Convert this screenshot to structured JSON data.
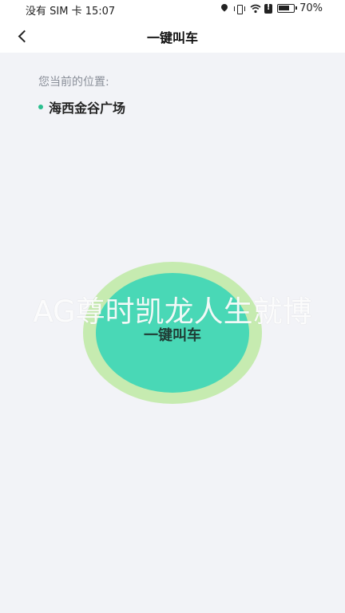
{
  "status_bar": {
    "carrier": "没有 SIM 卡",
    "time": "15:07",
    "battery_percent": "70%",
    "icons": [
      "location-pin-icon",
      "vibrate-icon",
      "wifi-icon",
      "alert-icon",
      "battery-icon"
    ]
  },
  "nav": {
    "back_icon": "chevron-left-icon",
    "title": "一键叫车"
  },
  "location": {
    "label": "您当前的位置:",
    "value": "海西金谷广场",
    "dot_color": "#2bbf8f"
  },
  "call_button": {
    "label": "一键叫车",
    "inner_color": "#49d8b6",
    "outer_color": "#c6ebb0"
  },
  "watermark": {
    "text": "AG尊时凯龙人生就博"
  },
  "colors": {
    "background": "#f2f3f7",
    "header": "#ffffff"
  }
}
